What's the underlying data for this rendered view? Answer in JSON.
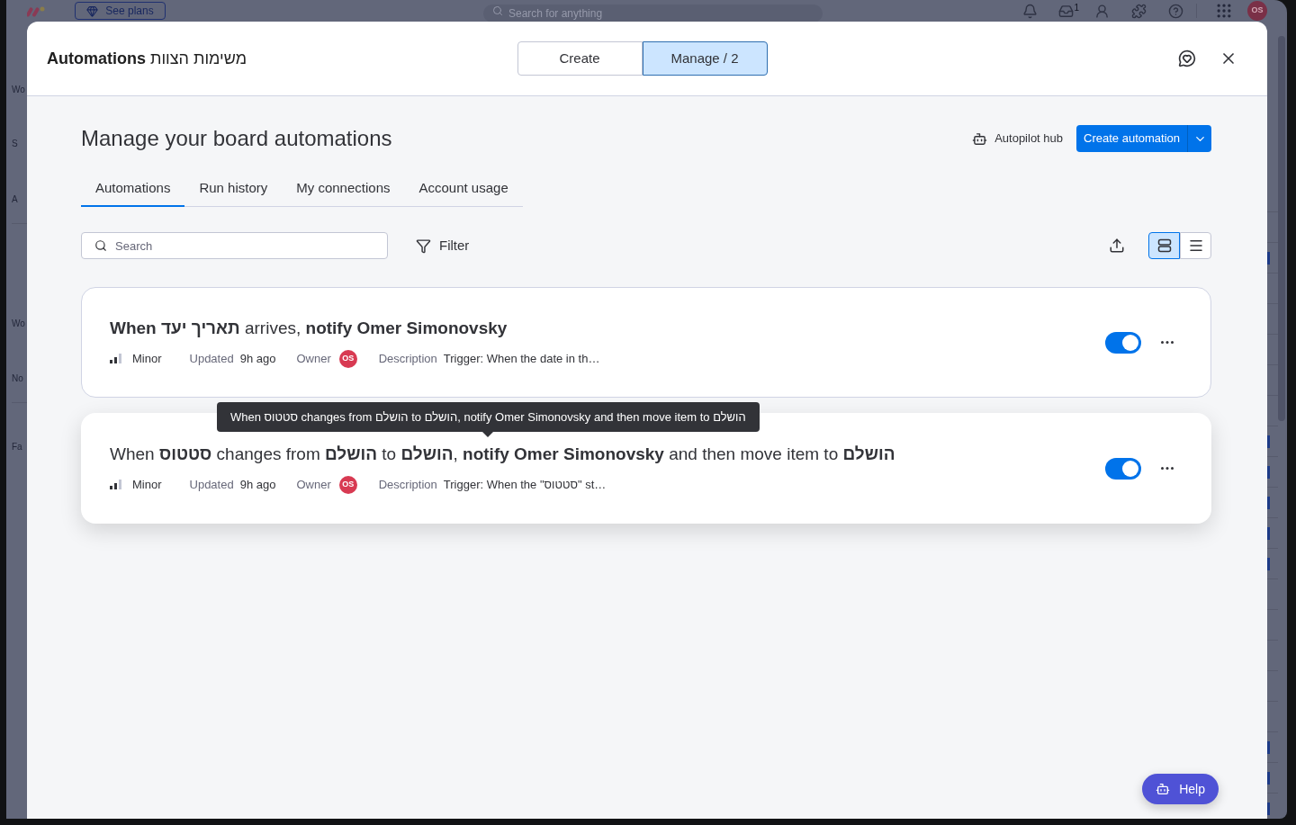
{
  "background": {
    "see_plans": "See plans",
    "search_placeholder": "Search for anything",
    "inbox_badge": "1",
    "avatar_initials": "OS",
    "sidebar_items": [
      "Wo",
      "S",
      "A",
      "Wo",
      "No",
      "Fa"
    ],
    "board_rows": [
      {
        "marked": false
      },
      {
        "marked": true
      },
      {
        "marked": false
      },
      {
        "marked": false
      },
      {
        "marked": false
      },
      {
        "marked": false
      },
      {
        "marked": false
      },
      {
        "marked": true
      },
      {
        "marked": true
      },
      {
        "marked": true
      },
      {
        "marked": true
      },
      {
        "marked": true
      },
      {
        "marked": false
      },
      {
        "marked": false
      },
      {
        "marked": false
      },
      {
        "marked": false
      },
      {
        "marked": false
      },
      {
        "marked": true
      },
      {
        "marked": true
      },
      {
        "marked": true
      }
    ]
  },
  "header": {
    "title": "Automations",
    "board_name": "משימות הצוות",
    "modes": [
      {
        "label": "Create",
        "selected": false
      },
      {
        "label": "Manage / 2",
        "selected": true
      }
    ]
  },
  "page": {
    "heading": "Manage your board automations",
    "autopilot_hub": "Autopilot hub",
    "create_button": "Create automation"
  },
  "tabs": [
    {
      "label": "Automations",
      "selected": true
    },
    {
      "label": "Run history",
      "selected": false
    },
    {
      "label": "My connections",
      "selected": false
    },
    {
      "label": "Account usage",
      "selected": false
    }
  ],
  "toolbar": {
    "search_placeholder": "Search",
    "filter": "Filter",
    "views": [
      {
        "kind": "cards",
        "selected": true
      },
      {
        "kind": "list",
        "selected": false
      }
    ]
  },
  "automations": [
    {
      "title": "**When תאריך יעד** arrives, **notify Omer Simonovsky**",
      "priority": "Minor",
      "updated_label": "Updated",
      "updated": "9h ago",
      "owner_label": "Owner",
      "owner_initials": "OS",
      "description_label": "Description",
      "description": "Trigger: When the date in th…",
      "on": true,
      "hovered": false
    },
    {
      "title": "When **סטטוס** changes from **הושלם** to **הושלם**, **notify Omer Simonovsky** and then move item to **הושלם**",
      "priority": "Minor",
      "updated_label": "Updated",
      "updated": "9h ago",
      "owner_label": "Owner",
      "owner_initials": "OS",
      "description_label": "Description",
      "description": "Trigger: When the \"סטטוס\" st…",
      "on": true,
      "hovered": true,
      "tooltip": "When סטטוס changes from הושלם to הושלם, notify Omer Simonovsky and then move item to הושלם"
    }
  ],
  "help_button": "Help"
}
